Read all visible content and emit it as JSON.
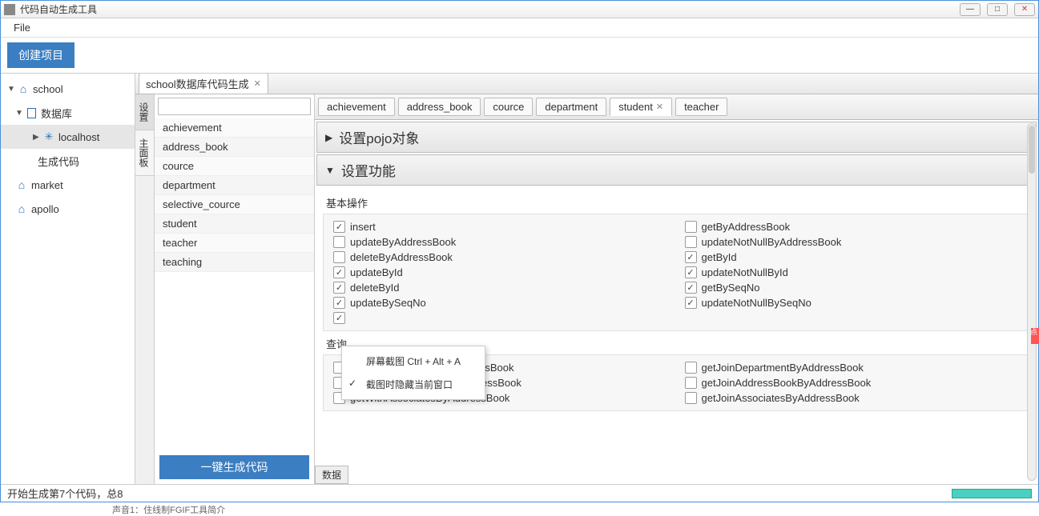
{
  "window": {
    "title": "代码自动生成工具"
  },
  "menubar": {
    "file": "File"
  },
  "toolbar": {
    "create": "创建项目"
  },
  "tree": {
    "items": [
      {
        "label": "school",
        "icon": "home",
        "level": 0,
        "expanded": true
      },
      {
        "label": "数据库",
        "icon": "db",
        "level": 1,
        "expanded": true
      },
      {
        "label": "localhost",
        "icon": "bt",
        "level": 2,
        "expanded": false,
        "selected": true
      },
      {
        "label": "生成代码",
        "icon": "",
        "level": 2
      },
      {
        "label": "market",
        "icon": "home",
        "level": 1
      },
      {
        "label": "apollo",
        "icon": "home",
        "level": 1
      }
    ]
  },
  "file_tab": {
    "label": "school数据库代码生成"
  },
  "vtabs": {
    "t0": "设置",
    "t1": "主面板"
  },
  "table_list": [
    "achievement",
    "address_book",
    "cource",
    "department",
    "selective_cource",
    "student",
    "teacher",
    "teaching"
  ],
  "gen_button": "一键生成代码",
  "entity_tabs": [
    {
      "label": "achievement",
      "active": false
    },
    {
      "label": "address_book",
      "active": false
    },
    {
      "label": "cource",
      "active": false
    },
    {
      "label": "department",
      "active": false
    },
    {
      "label": "student",
      "active": true,
      "closable": true
    },
    {
      "label": "teacher",
      "active": false
    }
  ],
  "acc": {
    "pojo": "设置pojo对象",
    "func": "设置功能"
  },
  "sections": {
    "basic": "基本操作",
    "query": "查询",
    "data": "数据"
  },
  "ops_basic": [
    {
      "l": "insert",
      "lc": true,
      "r": "getByAddressBook",
      "rc": false
    },
    {
      "l": "updateByAddressBook",
      "lc": false,
      "r": "updateNotNullByAddressBook",
      "rc": false
    },
    {
      "l": "deleteByAddressBook",
      "lc": false,
      "r": "getById",
      "rc": true
    },
    {
      "l": "updateById",
      "lc": true,
      "r": "updateNotNullById",
      "rc": true
    },
    {
      "l": "deleteById",
      "lc": true,
      "r": "getBySeqNo",
      "rc": true
    },
    {
      "l": "updateBySeqNo",
      "lc": true,
      "r": "updateNotNullBySeqNo",
      "rc": true
    },
    {
      "l": "",
      "lc": true,
      "r": "",
      "rc": false
    }
  ],
  "ops_query": [
    {
      "l": "getWithDepartmentByAddressBook",
      "lc": false,
      "r": "getJoinDepartmentByAddressBook",
      "rc": false
    },
    {
      "l": "getWithAddressBookByAddressBook",
      "lc": false,
      "r": "getJoinAddressBookByAddressBook",
      "rc": false
    },
    {
      "l": "getWithAssociatesByAddressBook",
      "lc": false,
      "r": "getJoinAssociatesByAddressBook",
      "rc": false
    }
  ],
  "context_menu": {
    "item1": "屏幕截图 Ctrl + Alt + A",
    "item2": "截图时隐藏当前窗口"
  },
  "status": {
    "text": "开始生成第7个代码，总8"
  },
  "side_tag": "点",
  "crop_text": "声音1：住线制FGIF工具简介"
}
